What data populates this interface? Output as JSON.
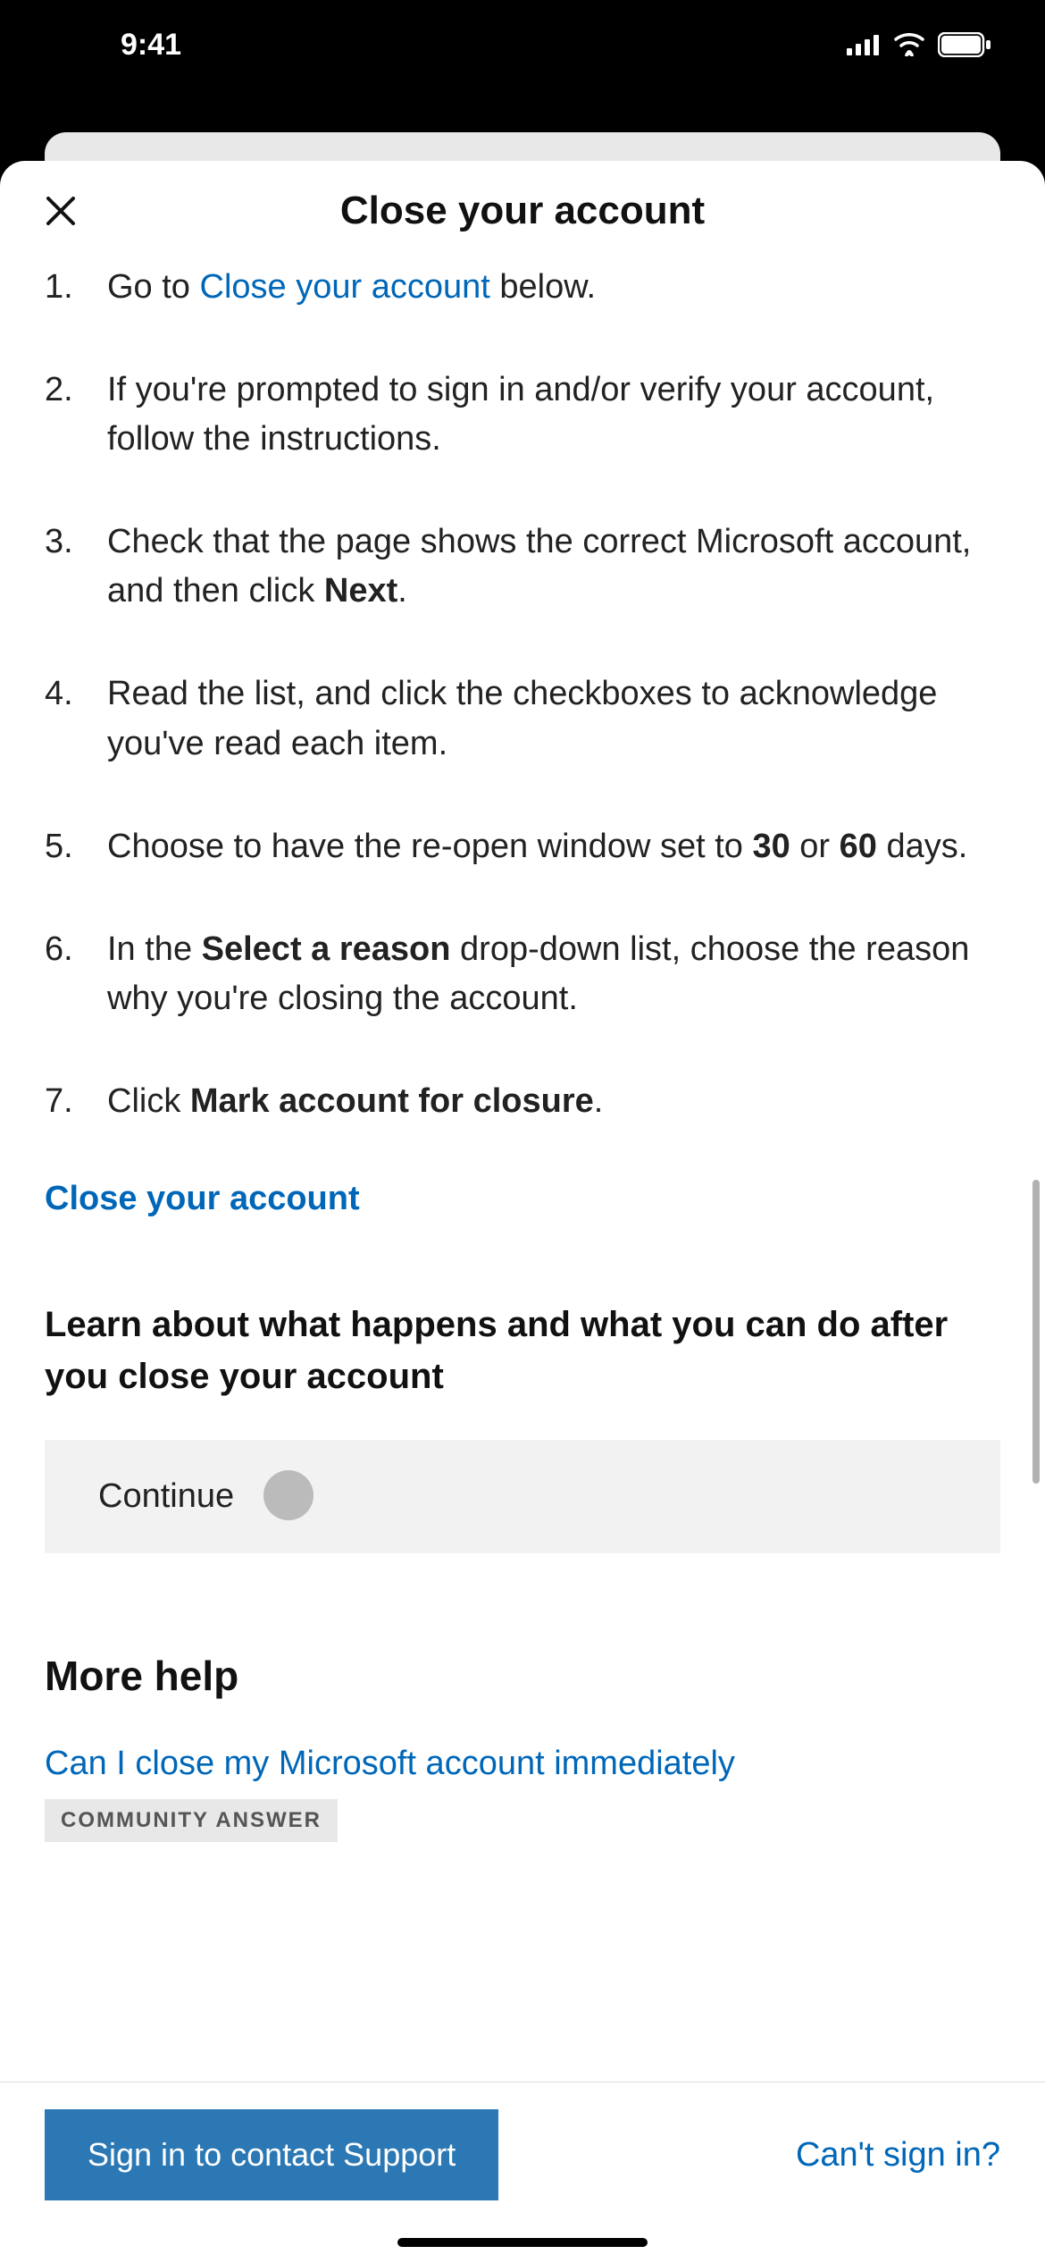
{
  "status": {
    "time": "9:41"
  },
  "header": {
    "title": "Close your account"
  },
  "steps": {
    "s1_pre": "Go to ",
    "s1_link": "Close your account",
    "s1_post": " below.",
    "s2": "If you're prompted to sign in and/or verify your account, follow the instructions.",
    "s3_pre": "Check that the page shows the correct Microsoft account, and then click ",
    "s3_b": "Next",
    "s3_post": ".",
    "s4": "Read the list, and click the checkboxes to acknowledge you've read each item.",
    "s5_pre": "Choose to have the re-open window set to ",
    "s5_b1": "30",
    "s5_mid": " or ",
    "s5_b2": "60",
    "s5_post": " days.",
    "s6_pre": "In the ",
    "s6_b": "Select a reason",
    "s6_post": " drop-down list, choose the reason why you're closing the account.",
    "s7_pre": "Click ",
    "s7_b": "Mark account for closure",
    "s7_post": "."
  },
  "links": {
    "close_account": "Close your account",
    "learn_heading": "Learn about what happens and what you can do after you close your account",
    "continue": "Continue",
    "more_help": "More help",
    "faq1": "Can I close my Microsoft account immediately",
    "badge": "COMMUNITY ANSWER"
  },
  "footer": {
    "signin": "Sign in to contact Support",
    "cant": "Can't sign in?"
  }
}
